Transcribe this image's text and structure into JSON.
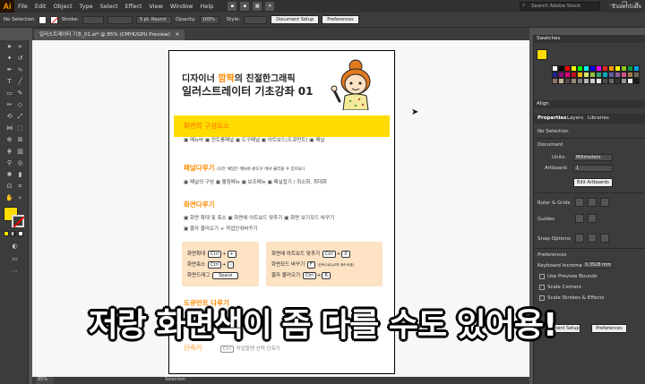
{
  "menu": {
    "logo": "Ai",
    "items": [
      "File",
      "Edit",
      "Object",
      "Type",
      "Select",
      "Effect",
      "View",
      "Window",
      "Help"
    ],
    "workspace": "Essentials",
    "search_placeholder": "Search Adobe Stock"
  },
  "control": {
    "selection": "No Selection",
    "stroke_label": "Stroke:",
    "brush": "5 pt. Round",
    "opacity_label": "Opacity:",
    "opacity_value": "100%",
    "style_label": "Style:",
    "doc_setup": "Document Setup",
    "preferences": "Preferences"
  },
  "tab": {
    "title": "일러스트레이터 기초_01.ai* @ 85% (CMYK/GPU Preview)"
  },
  "status": {
    "zoom": "85%",
    "mode": "Selection"
  },
  "panel": {
    "swatches_title": "Swatches",
    "align_title": "Align",
    "tabs": [
      "Properties",
      "Layers",
      "Libraries"
    ],
    "no_selection": "No Selection",
    "document_label": "Document",
    "units_label": "Units:",
    "units_value": "Millimeters",
    "artboard_label": "Artboard:",
    "artboard_value": "1",
    "edit_artboards": "Edit Artboards",
    "ruler_grids": "Ruler & Grids",
    "guides": "Guides",
    "snap_options": "Snap Options",
    "preferences_label": "Preferences",
    "keyboard_increment_label": "Keyboard Increment:",
    "keyboard_increment_value": "0.3528 mm",
    "use_preview_bounds": "Use Preview Bounds",
    "scale_corners": "Scale Corners",
    "scale_strokes": "Scale Strokes & Effects",
    "doc_setup_short": "ment Setup",
    "preferences_btn": "Preferences"
  },
  "swatch_colors": [
    "#ffffff",
    "#000000",
    "#ff0000",
    "#ffff00",
    "#00ff00",
    "#00ffff",
    "#0000ff",
    "#ff00ff",
    "#e52420",
    "#f39800",
    "#fff100",
    "#8fc31f",
    "#009944",
    "#00a0e9",
    "#1d2088",
    "#920783",
    "#e4007f",
    "#c30d23",
    "#f8b500",
    "#d7e46b",
    "#96c33d",
    "#33a474",
    "#00a7bf",
    "#5e5ea5",
    "#8e5c9e",
    "#d2508c",
    "#a67c52",
    "#736357",
    "#8b7262",
    "#c7b299",
    "#534741",
    "#998675",
    "#7d7d7d",
    "#b3b3b3",
    "#cccccc",
    "#e6e6e6",
    "#4d4d4d",
    "#666666",
    "#333333",
    "#999999",
    "#f2f2f2",
    "#1a1a1a"
  ],
  "artboard": {
    "header_pre": "디자이너 ",
    "header_accent": "깜짝",
    "header_post": "의 친절한그래픽",
    "header_line2": "일러스트레이터 기초강좌 01",
    "sec1_title": "화면의 구성요소",
    "sec1_items": "▣ 메뉴바  ▣ 컨트롤패널  ▣ 도구패널  ▣ 아트보드(도큐먼트)  ▣ 패널",
    "sec2_title": "패널다루기",
    "sec2_note": "(모든 패널은 메뉴바-윈도우 에서 불러올 수 있어요!)",
    "sec2_items": "▣ 패널의 구성  ▣ 펼침메뉴  ▣ 보조메뉴  ▣ 패널접기 / 최소화, 최대화",
    "sec3_title": "화면다루기",
    "sec3_line1": "▣ 화면 확대 및 축소  ▣ 화면에 아트보드 맞추기  ▣ 화면 보기모드 바꾸기",
    "sec3_line2": "▣ 줄자 불러오기 + 작업단위바꾸기",
    "k1": "화면확대",
    "k2": "화면축소",
    "k3": "화면드래그",
    "ctrl": "Ctrl",
    "plus": "+",
    "minus": "-",
    "space": "Space",
    "k4": "화면에 아트보드 맞추기",
    "k5": "화면모드 바꾸기",
    "k5_key": "F",
    "k5_note": "(단독으로누르면 계속 바뀜)",
    "k6": "줄자 불러오기",
    "zero": "0",
    "r": "R",
    "sec4_title": "도큐먼트 다루기",
    "sec5_title": "단축키",
    "sec5_note": "작업할땐 선택 단축키"
  },
  "subtitle": "저랑 화면색이 좀 다를 수도 있어용!"
}
